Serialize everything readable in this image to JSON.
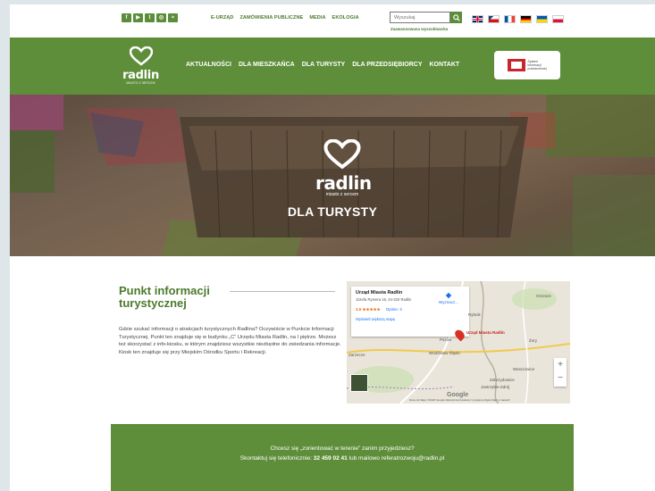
{
  "social": [
    "fb",
    "yt",
    "tw",
    "ig",
    "rss"
  ],
  "top_links": [
    "E-URZĄD",
    "ZAMÓWIENIA PUBLICZNE",
    "MEDIA",
    "EKOLOGIA"
  ],
  "search": {
    "placeholder": "Wyszukaj",
    "advanced_label": "Zaawansowana wyszukiwarka"
  },
  "languages": [
    "en",
    "cz",
    "fr",
    "de",
    "ua",
    "pl"
  ],
  "logo": {
    "word": "radlin",
    "tagline": "MIASTO Z SERCEM"
  },
  "menu": [
    "AKTUALNOŚCI",
    "DLA MIESZKAŃCA",
    "DLA TURYSTY",
    "DLA PRZEDSIĘBIORCY",
    "KONTAKT"
  ],
  "sip": {
    "text": "System informacji przestrzennej"
  },
  "hero": {
    "logo_word": "radlin",
    "logo_tagline": "miasto z sercem",
    "title": "DLA TURYSTY"
  },
  "info": {
    "title": "Punkt informacji turystycznej",
    "text": "Gdzie szukać informacji o atrakcjach turystycznych Radlina? Oczywiście w Punkcie Informacji Turystycznej. Punkt ten znajduje się w budynku „C” Urzędu Miasta Radlin, na I piętrze. Możesz też skorzystać z info-kiosku, w którym znajdziesz wszystkie niezbędne do zwiedzania informacje. Kiosk ten znajduje się przy Miejskim Ośrodku Sportu i Rekreacji."
  },
  "map": {
    "place_name": "Urząd Miasta Radlin",
    "address": "Józefa Rymera 15, 44-310 Radlin",
    "rating": "3.5 ★★★★★",
    "reviews": "Opinie: 3",
    "bigger_map": "Wyświetl większą mapę",
    "directions": "Wyznacz...",
    "pin_label": "Urząd Miasta Radlin",
    "towns": [
      "Orzesze",
      "Rybnik",
      "Żory",
      "Wodzisław Śląski",
      "Jastrzębie-Zdrój",
      "Pszów",
      "Zarzecze",
      "Warszowice",
      "Zebrzydowice"
    ],
    "google": "Google",
    "footer": "Dane do Mapy ©2020 Google   Warunki korzystania z programu   Zgłoś błąd w mapach",
    "zoom_in": "+",
    "zoom_out": "−"
  },
  "contact": {
    "line1": "Chcesz się „zorientować w terenie” zanim przyjedziesz?",
    "line2_prefix": "Skontaktuj się telefonicznie:",
    "phone": "32 459 02 41",
    "line2_mid": "lub mailowo",
    "email": "referatrozwoju@radlin.pl"
  },
  "colors": {
    "brand_green": "#5e8e3a",
    "accent_red": "#d93025"
  }
}
